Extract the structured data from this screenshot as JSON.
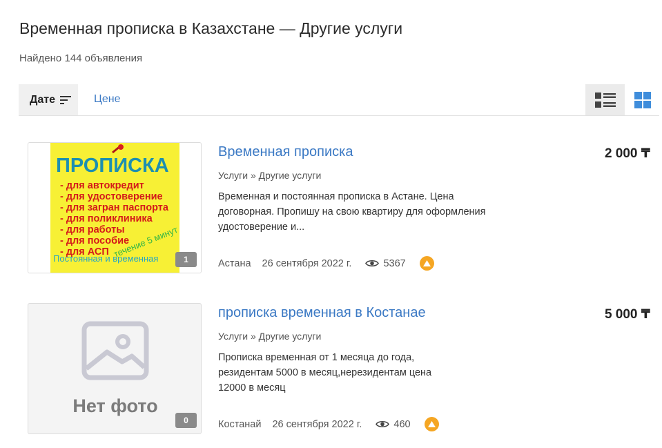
{
  "header": {
    "title": "Временная прописка в Казахстане — Другие услуги",
    "found": "Найдено 144 объявления"
  },
  "sort": {
    "date_label": "Дате",
    "price_label": "Цене",
    "active": "date",
    "view_mode": "list"
  },
  "colors": {
    "link": "#3b79c4",
    "badge": "#f5a623",
    "grid_icon": "#3f8ddb"
  },
  "listings": [
    {
      "title": "Временная прописка",
      "category": "Услуги » Другие услуги",
      "description": "Временная и постоянная прописка в Астане. Цена договорная. Пропишу на свою квартиру для оформления удостоверение и...",
      "city": "Астана",
      "date": "26 сентября 2022 г.",
      "views": "5367",
      "price": "2 000 ₸",
      "photo_count": "1",
      "photo": {
        "heading": "ПРОПИСКА",
        "lines": [
          "- для автокредит",
          "- для удостоверение",
          "- для загран паспорта",
          "- для поликлиника",
          "- для работы",
          "- для пособие",
          "- для АСП"
        ],
        "diagonal": "течение 5 минут",
        "footer": "Постоянная и временная"
      }
    },
    {
      "title": "прописка временная в Костанае",
      "category": "Услуги » Другие услуги",
      "description": "Прописка временная от 1 месяца до года, резидентам 5000 в месяц,нерезидентам цена 12000 в месяц",
      "city": "Костанай",
      "date": "26 сентября 2022 г.",
      "views": "460",
      "price": "5 000 ₸",
      "photo_count": "0",
      "no_photo_label": "Нет фото"
    }
  ]
}
